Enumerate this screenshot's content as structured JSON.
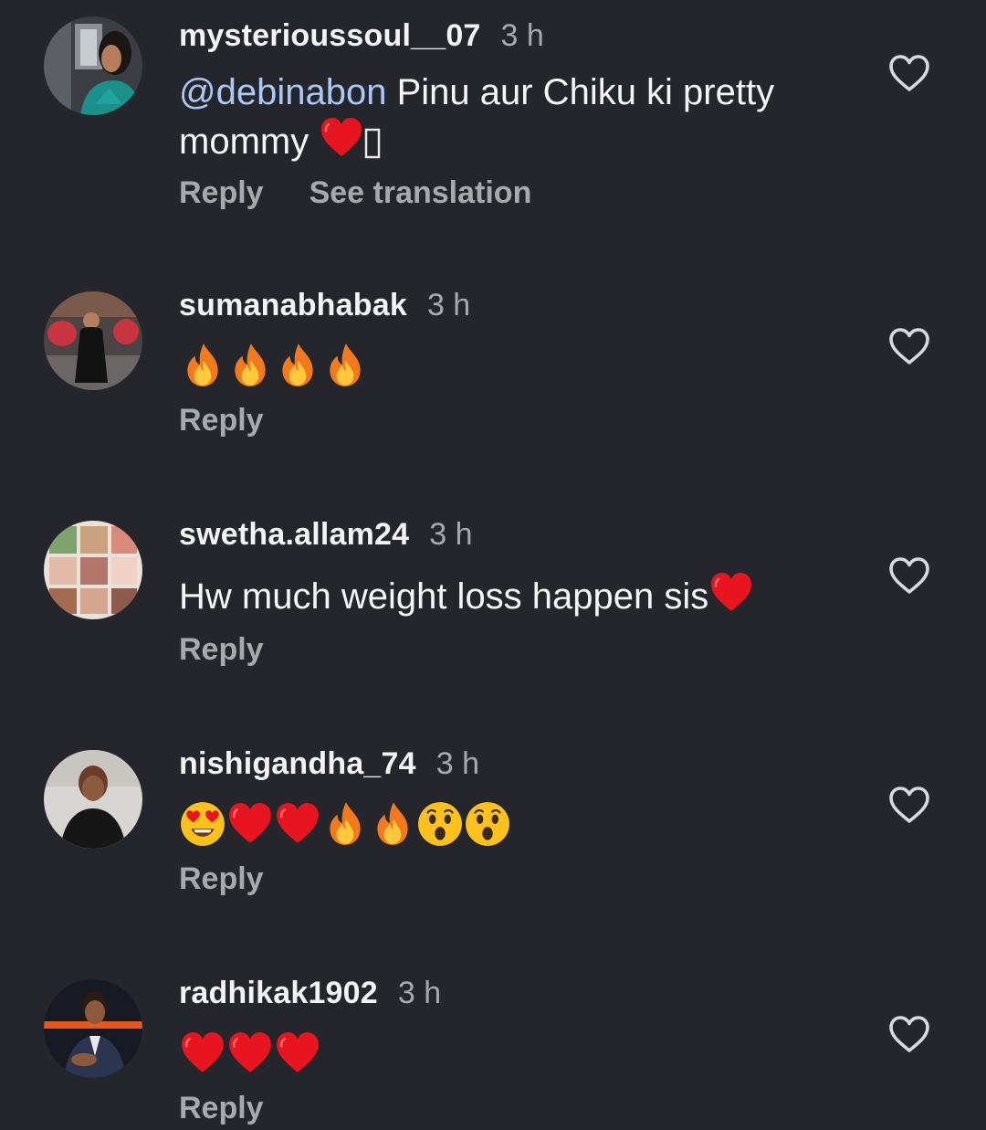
{
  "comments": [
    {
      "username": "mysterioussoul__07",
      "time": "3 h",
      "mention": "@debinabon",
      "text": " Pinu aur Chiku ki pretty mommy ",
      "emojis": [
        "heart",
        "missing-glyph"
      ],
      "actions": [
        "Reply",
        "See translation"
      ]
    },
    {
      "username": "sumanabhabak",
      "time": "3 h",
      "emojis": [
        "fire",
        "fire",
        "fire",
        "fire"
      ],
      "actions": [
        "Reply"
      ]
    },
    {
      "username": "swetha.allam24",
      "time": "3 h",
      "text": "Hw much weight loss happen sis",
      "emojis": [
        "heart"
      ],
      "actions": [
        "Reply"
      ]
    },
    {
      "username": "nishigandha_74",
      "time": "3 h",
      "emojis": [
        "heart-eyes",
        "heart",
        "heart",
        "fire",
        "fire",
        "astonished",
        "astonished"
      ],
      "actions": [
        "Reply"
      ]
    },
    {
      "username": "radhikak1902",
      "time": "3 h",
      "emojis": [
        "heart",
        "heart",
        "heart"
      ],
      "actions": [
        "Reply"
      ]
    }
  ],
  "icons": {
    "like": "heart-outline-icon"
  },
  "colors": {
    "background": "#25262b",
    "username": "#f3f3f3",
    "secondary": "#a8a9ad",
    "mention": "#a9c8f5",
    "emoji_heart": "#e8141f"
  }
}
